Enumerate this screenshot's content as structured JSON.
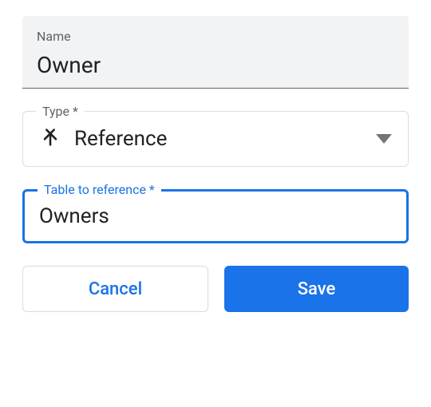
{
  "name_field": {
    "label": "Name",
    "value": "Owner"
  },
  "type_field": {
    "label": "Type *",
    "value": "Reference",
    "icon": "merge-icon"
  },
  "reference_field": {
    "label": "Table to reference *",
    "value": "Owners"
  },
  "buttons": {
    "cancel": "Cancel",
    "save": "Save"
  }
}
